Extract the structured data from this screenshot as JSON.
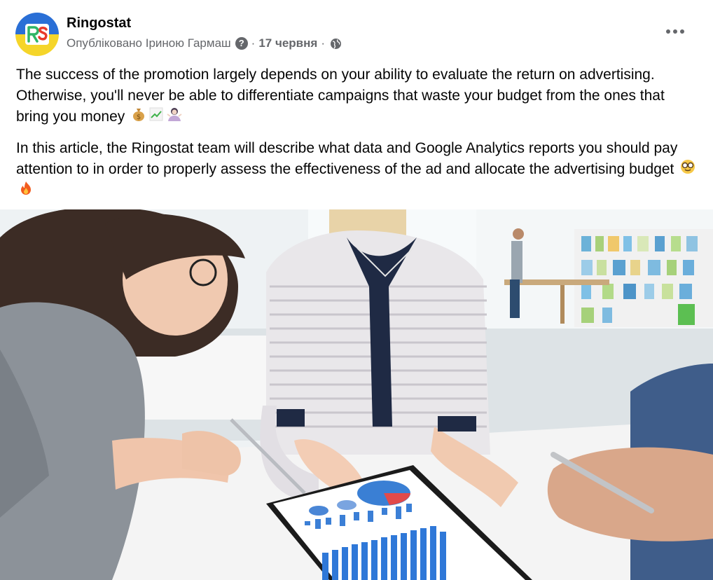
{
  "page": {
    "name": "Ringostat",
    "published_by": "Опубліковано Іриною Гармаш",
    "help_glyph": "?",
    "separator": "·",
    "date": "17 червня",
    "brand_colors": {
      "blue": "#2a6fd6",
      "yellow": "#f5d52a",
      "green": "#2fb566",
      "red": "#e8392b"
    }
  },
  "post": {
    "paragraph_1": "The success of the promotion largely depends on your ability to evaluate the return on advertising. Otherwise, you'll never be able to differentiate campaigns that waste your budget from the ones that bring you money",
    "paragraph_1_emojis": [
      "money-bag",
      "chart-increasing",
      "person-gesturing"
    ],
    "paragraph_2": "In this article, the Ringostat team will describe what data and Google Analytics reports you should pay attention to in order to properly assess the effectiveness of the ad and allocate the advertising budget",
    "paragraph_2_emojis": [
      "nerd-face",
      "fire"
    ]
  },
  "icons": {
    "avatar": "ringostat-logo-icon",
    "help": "question-circle-icon",
    "audience": "globe-icon",
    "more": "more-horizontal-icon"
  }
}
